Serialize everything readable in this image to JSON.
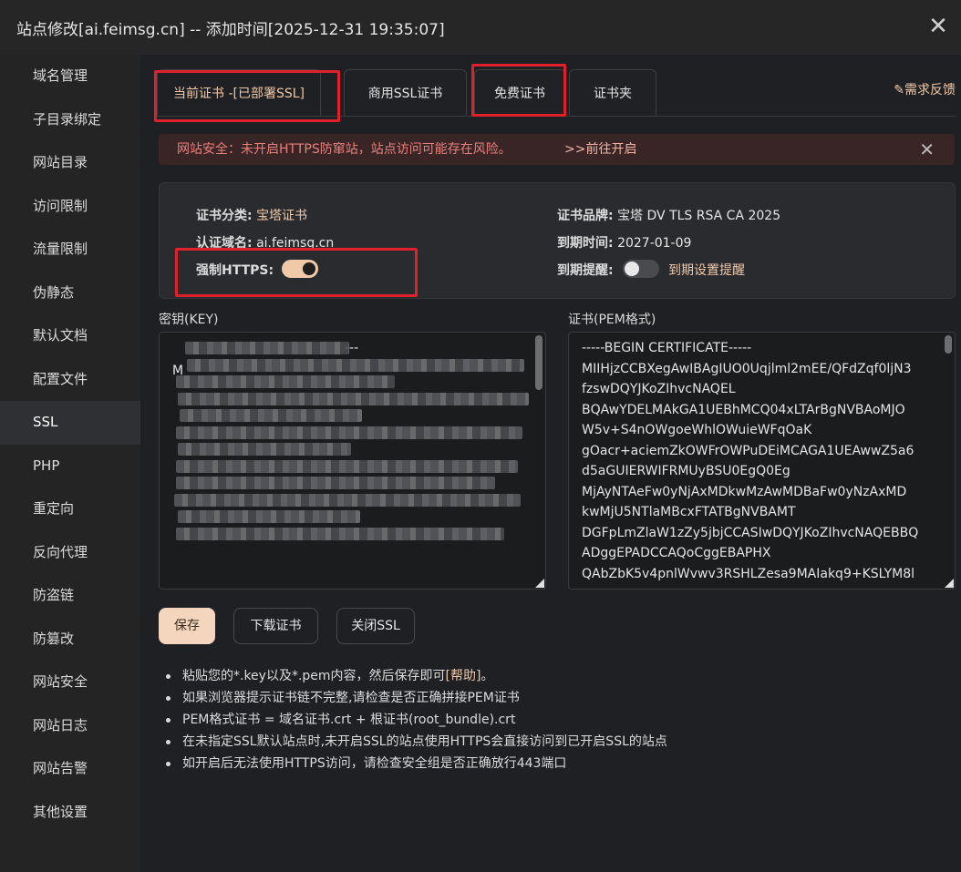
{
  "window": {
    "title": "站点修改[ai.feimsg.cn] -- 添加时间[2025-12-31 19:35:07]"
  },
  "sidebar": {
    "items": [
      {
        "label": "域名管理"
      },
      {
        "label": "子目录绑定"
      },
      {
        "label": "网站目录"
      },
      {
        "label": "访问限制"
      },
      {
        "label": "流量限制"
      },
      {
        "label": "伪静态"
      },
      {
        "label": "默认文档"
      },
      {
        "label": "配置文件"
      },
      {
        "label": "SSL"
      },
      {
        "label": "PHP"
      },
      {
        "label": "重定向"
      },
      {
        "label": "反向代理"
      },
      {
        "label": "防盗链"
      },
      {
        "label": "防篡改"
      },
      {
        "label": "网站安全"
      },
      {
        "label": "网站日志"
      },
      {
        "label": "网站告警"
      },
      {
        "label": "其他设置"
      }
    ],
    "active": "SSL"
  },
  "tabs": [
    {
      "label": "当前证书 -[已部署SSL]"
    },
    {
      "label": "商用SSL证书"
    },
    {
      "label": "免费证书"
    },
    {
      "label": "证书夹"
    }
  ],
  "feedback_label": "需求反馈",
  "alert": {
    "text": "网站安全：未开启HTTPS防窜站，站点访问可能存在风险。",
    "link": ">>前往开启"
  },
  "cert_info": {
    "category_label": "证书分类:",
    "category_value": "宝塔证书",
    "brand_label": "证书品牌:",
    "brand_value": "宝塔 DV TLS RSA CA 2025",
    "domain_label": "认证域名:",
    "domain_value": "ai.feimsg.cn",
    "expire_label": "到期时间:",
    "expire_value": "2027-01-09",
    "force_https_label": "强制HTTPS:",
    "force_https_on": true,
    "remind_label": "到期提醒:",
    "remind_on": false,
    "remind_link": "到期设置提醒"
  },
  "key_field": {
    "label": "密钥(KEY)",
    "first_line_tail": "---",
    "second_line_head": "M"
  },
  "cert_field": {
    "label": "证书(PEM格式)",
    "lines": [
      "-----BEGIN CERTIFICATE-----",
      "MIIHjzCCBXegAwIBAgIUO0Uqjlml2mEE/QFdZqf0ljN3",
      "fzswDQYJKoZIhvcNAQEL",
      "BQAwYDELMAkGA1UEBhMCQ04xLTArBgNVBAoMJO",
      "W5v+S4nOWgoeWhlOWuieWFqOaK",
      "gOacr+aciemZkOWFrOWPuDEiMCAGA1UEAwwZ5a6",
      "d5aGUIERWIFRMUyBSU0EgQ0Eg",
      "MjAyNTAeFw0yNjAxMDkwMzAwMDBaFw0yNzAxMD",
      "kwMjU5NTlaMBcxFTATBgNVBAMT",
      "DGFpLmZlaW1zZy5jbjCCASIwDQYJKoZIhvcNAQEBBQ",
      "ADggEPADCCAQoCggEBAPHX",
      "QAbZbK5v4pnlWvwv3RSHLZesa9MAIakq9+KSLYM8l"
    ]
  },
  "buttons": {
    "save": "保存",
    "download": "下载证书",
    "close_ssl": "关闭SSL"
  },
  "tips": [
    {
      "text": "粘贴您的*.key以及*.pem内容，然后保存即可",
      "link": "[帮助]",
      "suffix": "。"
    },
    {
      "text": "如果浏览器提示证书链不完整,请检查是否正确拼接PEM证书"
    },
    {
      "text": "PEM格式证书 = 域名证书.crt + 根证书(root_bundle).crt"
    },
    {
      "text": "在未指定SSL默认站点时,未开启SSL的站点使用HTTPS会直接访问到已开启SSL的站点"
    },
    {
      "text": "如开启后无法使用HTTPS访问，请检查安全组是否正确放行443端口"
    }
  ],
  "colors": {
    "accent": "#f0c9a8",
    "highlight_box": "#e0202a",
    "alert_text": "#e8807c"
  }
}
